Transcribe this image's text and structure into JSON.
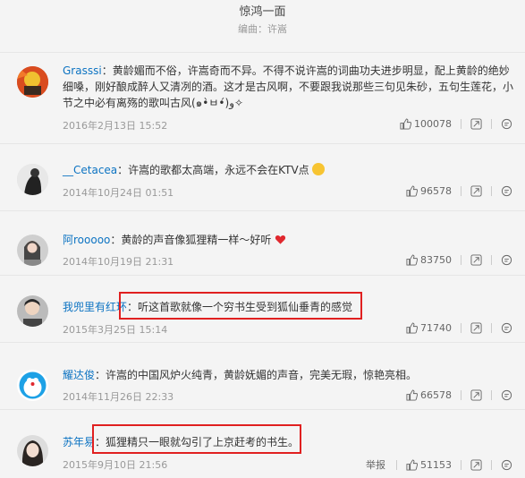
{
  "song": {
    "title": "惊鸿一面",
    "subtitle": "编曲：许嵩"
  },
  "comments": [
    {
      "user": "Grasssi",
      "sep": "：",
      "text": "黄龄媚而不俗，许嵩奇而不异。不得不说许嵩的词曲功夫进步明显，配上黄龄的绝妙细嗓，刚好酿成醉人又清冽的酒。这才是古风啊，不要跟我说那些三句见朱砂，五句生莲花，小节之中必有离殇的歌叫古风(๑•̀ㅂ•́)و✧",
      "text_display": "黄龄媚而不俗，许嵩奇而不异。不得不说许嵩的词曲功夫进步明显，配上黄龄的绝妙细嗓，刚好酿成醉人又清冽的酒。这才是古风啊，不要跟我说那些三句见朱砂，五句生莲花，小节之中必有离殇的歌叫古风(๑•̀ㅂ•́)و✧",
      "date": "2016年2月13日 15:52",
      "likes": "100078"
    },
    {
      "user": "__Cetacea",
      "sep": "：",
      "text": "许嵩的歌都太高端，永远不会在KTV点",
      "date": "2014年10月24日 01:51",
      "likes": "96578"
    },
    {
      "user": "阿rooooo",
      "sep": "：",
      "text": "黄龄的声音像狐狸精一样～好听",
      "date": "2014年10月19日 21:31",
      "likes": "83750"
    },
    {
      "user": "我兜里有红环",
      "sep": "：",
      "text": "听这首歌就像一个穷书生受到狐仙垂青的感觉",
      "date": "2015年3月25日 15:14",
      "likes": "71740"
    },
    {
      "user": "耀达俊",
      "sep": "：",
      "text": "许嵩的中国风炉火纯青，黄龄妩媚的声音，完美无瑕，惊艳亮相。",
      "date": "2014年11月26日 22:33",
      "likes": "66578"
    },
    {
      "user": "苏年易",
      "sep": "：",
      "text": "狐狸精只一眼就勾引了上京赶考的书生。",
      "date": "2015年9月10日 21:56",
      "likes": "51153",
      "report": "举报"
    }
  ],
  "colors": {
    "username": "#0c73c2",
    "highlight": "#e02020",
    "heart": "#e0282e"
  },
  "icons": [
    "thumb-up-icon",
    "share-icon",
    "reply-icon",
    "heart-icon",
    "laugh-emoji-icon"
  ]
}
